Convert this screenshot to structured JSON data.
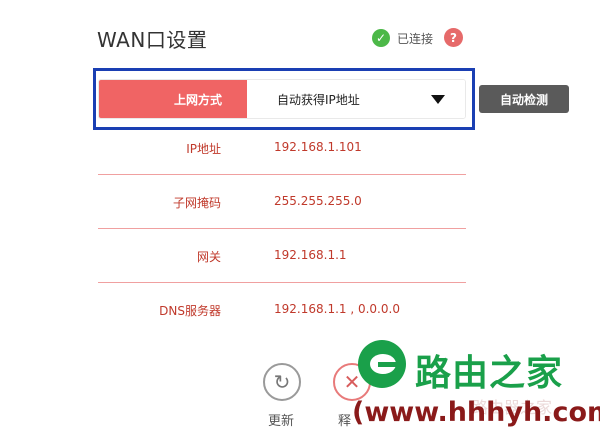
{
  "header": {
    "title": "WAN口设置",
    "status_text": "已连接",
    "status_icon": "check-circle-icon",
    "help_glyph": "?",
    "colors": {
      "status_ok": "#4cb848",
      "help": "#e66a6a"
    }
  },
  "connection": {
    "label": "上网方式",
    "selected": "自动获得IP地址",
    "detect_button": "自动检测",
    "colors": {
      "label_bg": "#f06464",
      "highlight": "#1a3fb3",
      "detect_bg": "#5a5a5a"
    }
  },
  "info": [
    {
      "key": "IP地址",
      "value": "192.168.1.101"
    },
    {
      "key": "子网掩码",
      "value": "255.255.255.0"
    },
    {
      "key": "网关",
      "value": "192.168.1.1"
    },
    {
      "key": "DNS服务器",
      "value": "192.168.1.1 , 0.0.0.0"
    }
  ],
  "actions": {
    "refresh_label": "更新",
    "release_label": "释"
  },
  "watermark": {
    "title": "路由之家",
    "url": "(www.hhhyh.com)",
    "faint": "路由器之家",
    "color": "#1aa04a"
  }
}
